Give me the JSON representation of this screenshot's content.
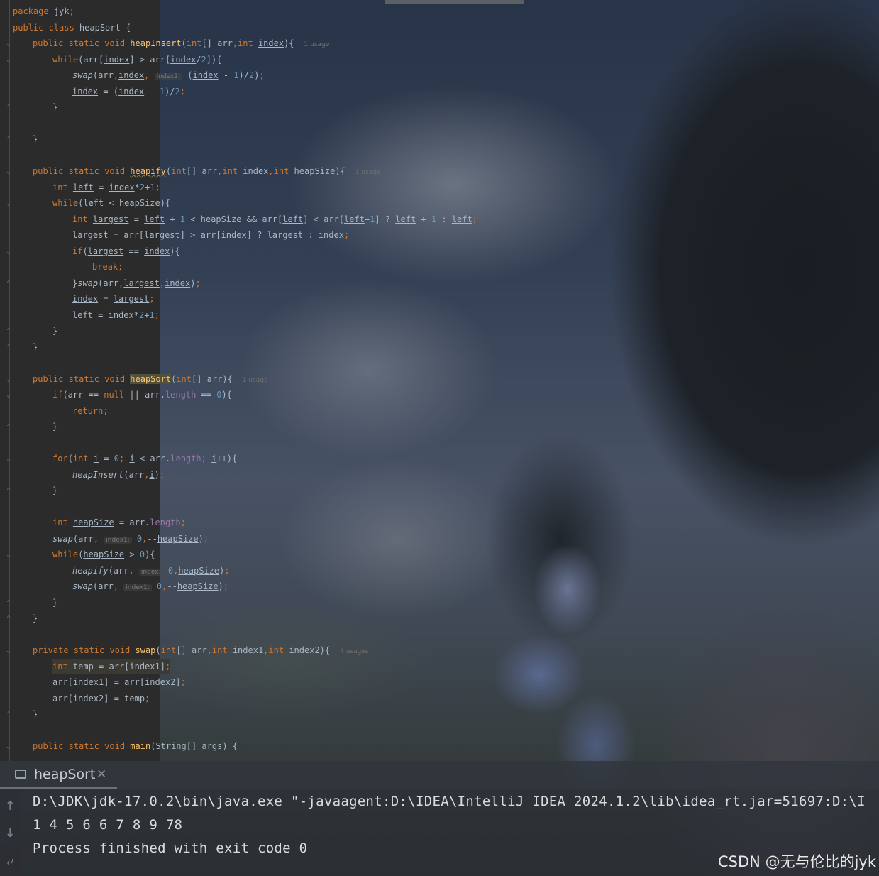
{
  "editor": {
    "package_kw": "package",
    "package_name": "jyk",
    "class_decl": "public class heapSort {",
    "usage_1": "1 usage",
    "usage_4": "4 usages",
    "hint_index2": "index2:",
    "hint_index1": "index1:",
    "hint_index": "index:"
  },
  "run_panel": {
    "tab_label": "heapSort",
    "close_glyph": "✕",
    "console_lines": [
      "D:\\JDK\\jdk-17.0.2\\bin\\java.exe \"-javaagent:D:\\IDEA\\IntelliJ IDEA 2024.1.2\\lib\\idea_rt.jar=51697:D:\\I",
      "1 4 5 6 6 7 8 9 78",
      "Process finished with exit code 0"
    ]
  },
  "watermark": "CSDN @无与伦比的jyk",
  "icons": {
    "up": "↑",
    "down": "↓",
    "wrap": "⤶"
  }
}
